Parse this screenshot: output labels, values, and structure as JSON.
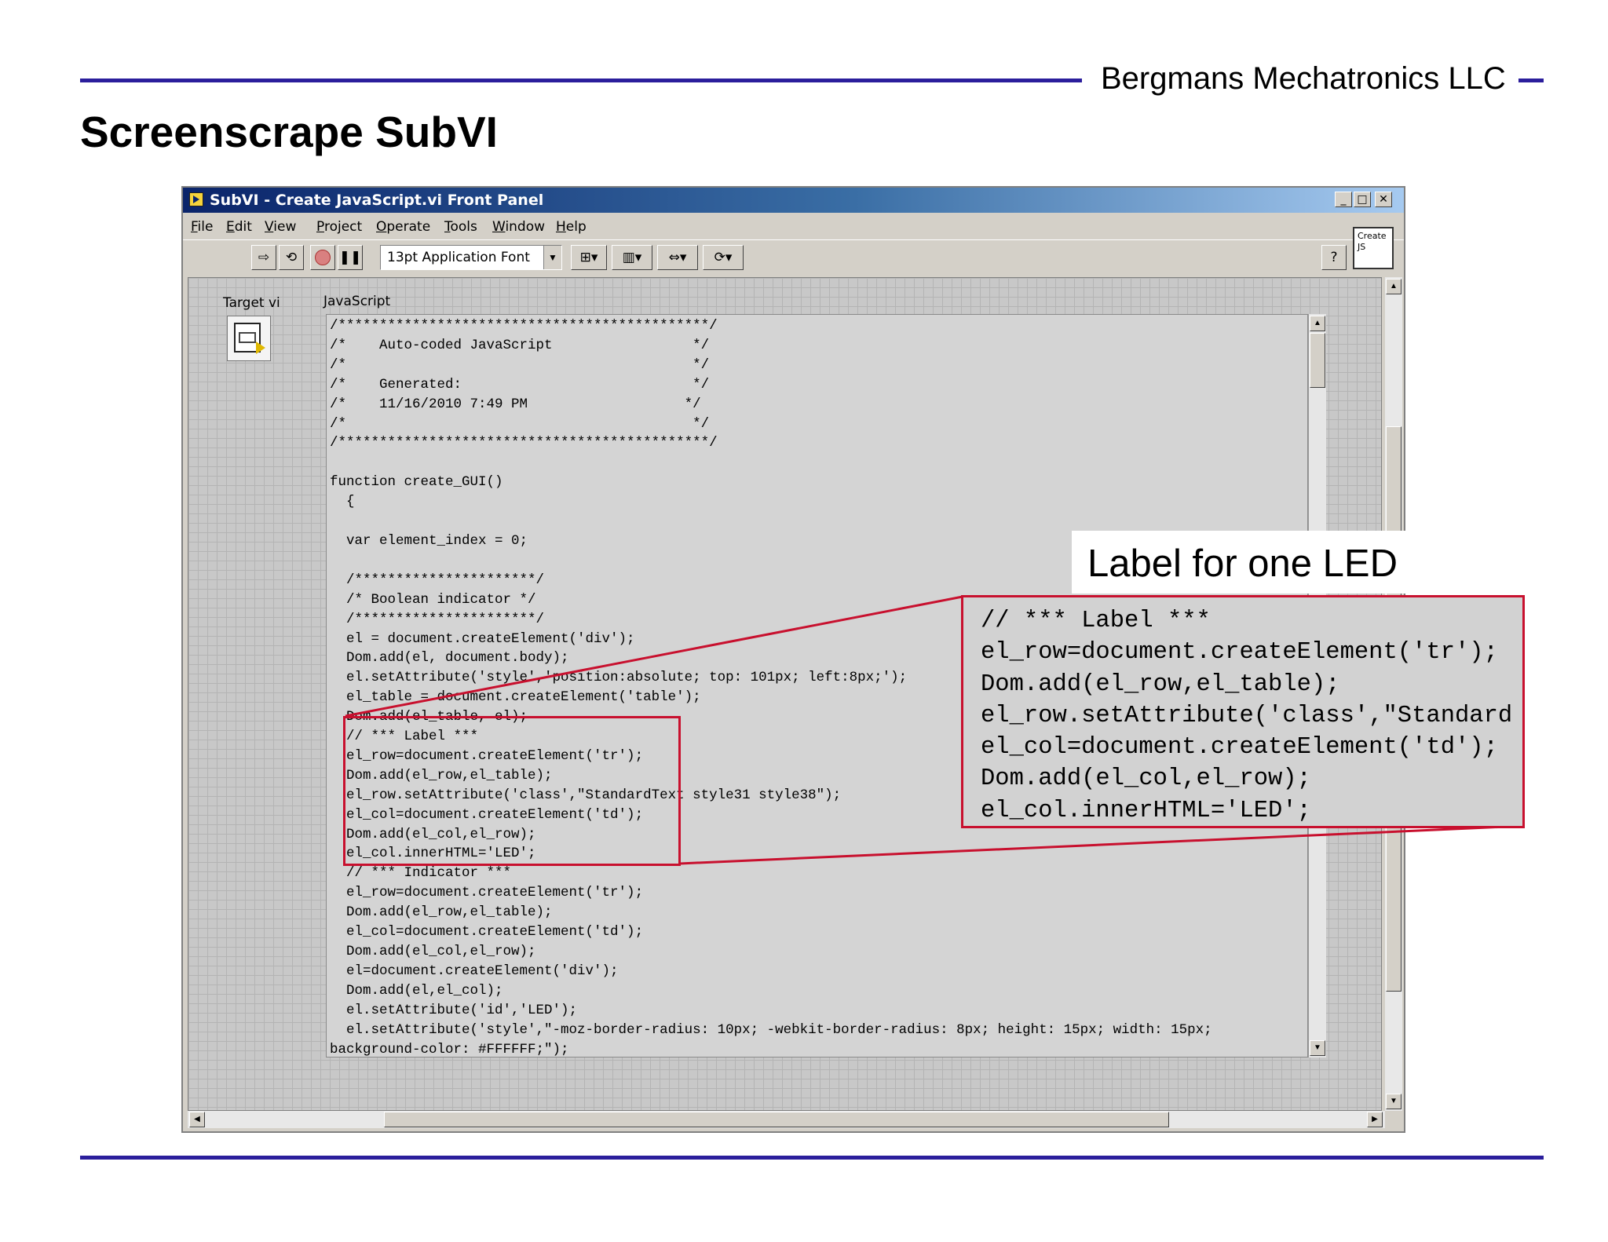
{
  "header": {
    "company": "Bergmans Mechatronics LLC",
    "title": "Screenscrape SubVI"
  },
  "window": {
    "title": "SubVI - Create JavaScript.vi Front Panel",
    "controls": {
      "minimize": "_",
      "maximize": "□",
      "close": "✕"
    },
    "menu": [
      "File",
      "Edit",
      "View",
      "Project",
      "Operate",
      "Tools",
      "Window",
      "Help"
    ],
    "toolbar": {
      "run_icon": "run-arrow-icon",
      "continuous_run_icon": "continuous-run-icon",
      "abort_icon": "abort-icon",
      "pause_icon": "pause-icon",
      "font": "13pt Application Font",
      "align_icon": "align-objects-icon",
      "distribute_icon": "distribute-objects-icon",
      "resize_icon": "resize-objects-icon",
      "reorder_icon": "reorder-icon",
      "help_icon": "context-help-icon"
    },
    "vi_icon_text": "Create JS"
  },
  "panel": {
    "target_label": "Target vi",
    "javascript_label": "JavaScript",
    "code_lines": [
      "/*********************************************/",
      "/*    Auto-coded JavaScript                 */",
      "/*                                          */",
      "/*    Generated:                            */",
      "/*    11/16/2010 7:49 PM                   */",
      "/*                                          */",
      "/*********************************************/",
      "",
      "function create_GUI()",
      "  {",
      "",
      "  var element_index = 0;",
      "",
      "  /**********************/",
      "  /* Boolean indicator */",
      "  /**********************/",
      "  el = document.createElement('div');",
      "  Dom.add(el, document.body);",
      "  el.setAttribute('style','position:absolute; top: 101px; left:8px;');",
      "  el_table = document.createElement('table');",
      "  Dom.add(el_table, el);",
      "  // *** Label ***",
      "  el_row=document.createElement('tr');",
      "  Dom.add(el_row,el_table);",
      "  el_row.setAttribute('class',\"StandardText style31 style38\");",
      "  el_col=document.createElement('td');",
      "  Dom.add(el_col,el_row);",
      "  el_col.innerHTML='LED';",
      "  // *** Indicator ***",
      "  el_row=document.createElement('tr');",
      "  Dom.add(el_row,el_table);",
      "  el_col=document.createElement('td');",
      "  Dom.add(el_col,el_row);",
      "  el=document.createElement('div');",
      "  Dom.add(el,el_col);",
      "  el.setAttribute('id','LED');",
      "  el.setAttribute('style',\"-moz-border-radius: 10px; -webkit-border-radius: 8px; height: 15px; width: 15px;",
      "background-color: #FFFFFF;\");"
    ]
  },
  "callout": {
    "title": "Label for one LED",
    "zoom_lines": [
      "// *** Label ***",
      "el_row=document.createElement('tr');",
      "Dom.add(el_row,el_table);",
      "el_row.setAttribute('class',\"Standard",
      "el_col=document.createElement('td');",
      "Dom.add(el_col,el_row);",
      "el_col.innerHTML='LED';"
    ],
    "color": "#c8102e"
  },
  "colors": {
    "rule": "#2b1e9c",
    "titlebar": "#0a246a"
  }
}
